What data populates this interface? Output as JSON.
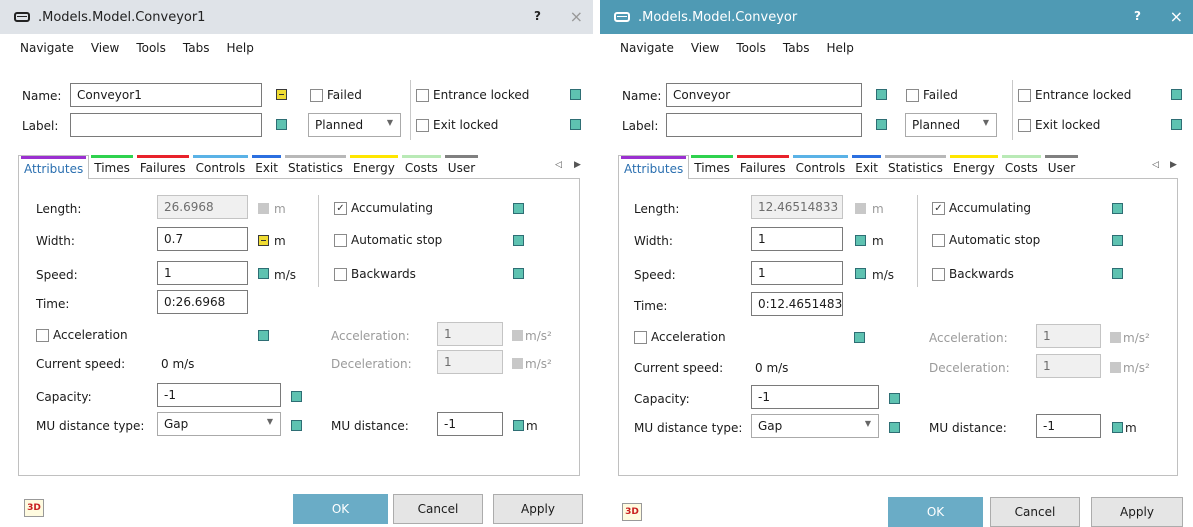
{
  "colors": {
    "attributes": "#9b30d0",
    "times": "#2fd24e",
    "failures": "#e8222a",
    "controls": "#5ab2e6",
    "exit": "#2b6fe0",
    "statistics": "#b8b8b8",
    "energy": "#ffe600",
    "costs": "#b9eab6",
    "user": "#808080"
  },
  "dialog1": {
    "title": ".Models.Model.Conveyor1",
    "help": "?",
    "close": "×",
    "menu": [
      "Navigate",
      "View",
      "Tools",
      "Tabs",
      "Help"
    ],
    "name_label": "Name:",
    "name_value": "Conveyor1",
    "label_label": "Label:",
    "label_value": "",
    "failed": "Failed",
    "planned": "Planned",
    "entrance_locked": "Entrance locked",
    "exit_locked": "Exit locked",
    "tabs": [
      "Attributes",
      "Times",
      "Failures",
      "Controls",
      "Exit",
      "Statistics",
      "Energy",
      "Costs",
      "User"
    ],
    "tab_prev": "◁",
    "tab_next": "▶",
    "length_label": "Length:",
    "length_value": "26.6968",
    "length_unit": "m",
    "width_label": "Width:",
    "width_value": "0.7",
    "width_unit": "m",
    "speed_label": "Speed:",
    "speed_value": "1",
    "speed_unit": "m/s",
    "time_label": "Time:",
    "time_value": "0:26.6968",
    "accumulating": "Accumulating",
    "accumulating_check": "✓",
    "automatic_stop": "Automatic stop",
    "backwards": "Backwards",
    "acceleration_chk": "Acceleration",
    "acceleration_label": "Acceleration:",
    "acceleration_value": "1",
    "acceleration_unit": "m/s²",
    "current_speed_label": "Current speed:",
    "current_speed_value": "0 m/s",
    "deceleration_label": "Deceleration:",
    "deceleration_value": "1",
    "deceleration_unit": "m/s²",
    "capacity_label": "Capacity:",
    "capacity_value": "-1",
    "mu_type_label": "MU distance type:",
    "mu_type_value": "Gap",
    "mu_distance_label": "MU distance:",
    "mu_distance_value": "-1",
    "mu_distance_unit": "m",
    "threed": "3D",
    "ok": "OK",
    "cancel": "Cancel",
    "apply": "Apply"
  },
  "dialog2": {
    "title": ".Models.Model.Conveyor",
    "help": "?",
    "close": "×",
    "menu": [
      "Navigate",
      "View",
      "Tools",
      "Tabs",
      "Help"
    ],
    "name_label": "Name:",
    "name_value": "Conveyor",
    "label_label": "Label:",
    "label_value": "",
    "failed": "Failed",
    "planned": "Planned",
    "entrance_locked": "Entrance locked",
    "exit_locked": "Exit locked",
    "tabs": [
      "Attributes",
      "Times",
      "Failures",
      "Controls",
      "Exit",
      "Statistics",
      "Energy",
      "Costs",
      "User"
    ],
    "tab_prev": "◁",
    "tab_next": "▶",
    "length_label": "Length:",
    "length_value": "12.46514833",
    "length_unit": "m",
    "width_label": "Width:",
    "width_value": "1",
    "width_unit": "m",
    "speed_label": "Speed:",
    "speed_value": "1",
    "speed_unit": "m/s",
    "time_label": "Time:",
    "time_value": "0:12.4651483",
    "accumulating": "Accumulating",
    "accumulating_check": "✓",
    "automatic_stop": "Automatic stop",
    "backwards": "Backwards",
    "acceleration_chk": "Acceleration",
    "acceleration_label": "Acceleration:",
    "acceleration_value": "1",
    "acceleration_unit": "m/s²",
    "current_speed_label": "Current speed:",
    "current_speed_value": "0 m/s",
    "deceleration_label": "Deceleration:",
    "deceleration_value": "1",
    "deceleration_unit": "m/s²",
    "capacity_label": "Capacity:",
    "capacity_value": "-1",
    "mu_type_label": "MU distance type:",
    "mu_type_value": "Gap",
    "mu_distance_label": "MU distance:",
    "mu_distance_value": "-1",
    "mu_distance_unit": "m",
    "threed": "3D",
    "ok": "OK",
    "cancel": "Cancel",
    "apply": "Apply"
  }
}
